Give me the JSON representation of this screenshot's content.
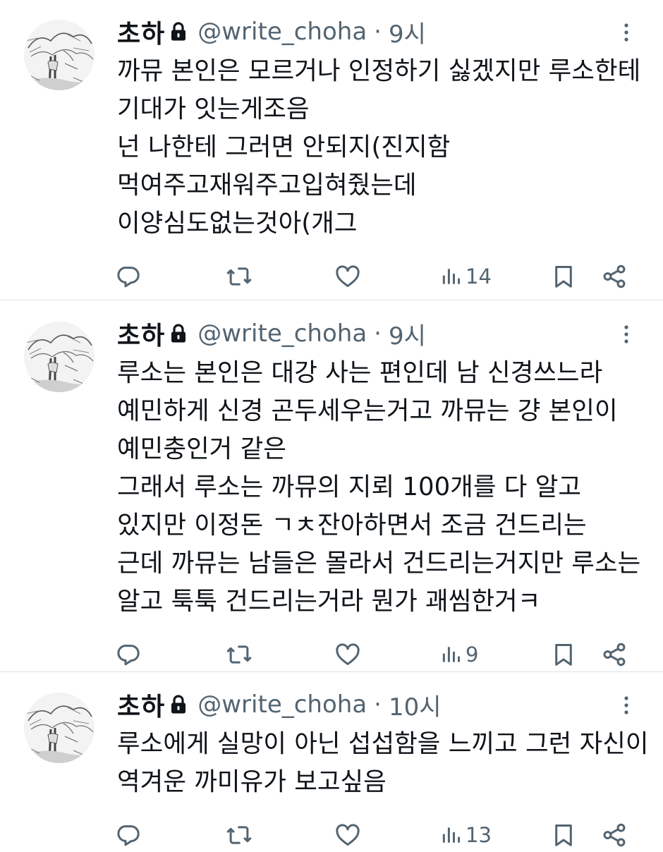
{
  "tweets": [
    {
      "author": {
        "name": "초하",
        "handle": "@write_choha",
        "locked": true
      },
      "time": "9시",
      "lines": [
        "까뮤 본인은 모르거나 인정하기 싫겠지만  루소한테",
        "기대가 잇는게조음",
        "넌 나한테 그러면 안되지(진지함",
        "먹여주고재워주고입혀줬는데",
        "이양심도없는것아(개그"
      ],
      "views": "14"
    },
    {
      "author": {
        "name": "초하",
        "handle": "@write_choha",
        "locked": true
      },
      "time": "9시",
      "lines": [
        "루소는 본인은 대강 사는 편인데 남 신경쓰느라",
        "예민하게 신경 곤두세우는거고 까뮤는 걍 본인이",
        "예민충인거 같은",
        "그래서 루소는 까뮤의 지뢰 100개를 다 알고",
        "있지만 이정돈 ㄱㅊ잔아하면서 조금 건드리는",
        "근데 까뮤는 남들은 몰라서 건드리는거지만 루소는",
        "알고 툭툭 건드리는거라 뭔가 괘씸한거ㅋ"
      ],
      "views": "9"
    },
    {
      "author": {
        "name": "초하",
        "handle": "@write_choha",
        "locked": true
      },
      "time": "10시",
      "lines": [
        "루소에게 실망이 아닌 섭섭함을 느끼고 그런 자신이",
        "역겨운 까미유가 보고싶음"
      ],
      "views": "13"
    }
  ],
  "icons": {
    "reply": "reply-icon",
    "retweet": "retweet-icon",
    "like": "heart-icon",
    "views": "views-chart-icon",
    "bookmark": "bookmark-icon",
    "share": "share-icon",
    "more": "more-dots-icon",
    "lock": "lock-icon"
  },
  "colors": {
    "text": "#0f1419",
    "secondary": "#536471",
    "divider": "#dfe3e6"
  }
}
